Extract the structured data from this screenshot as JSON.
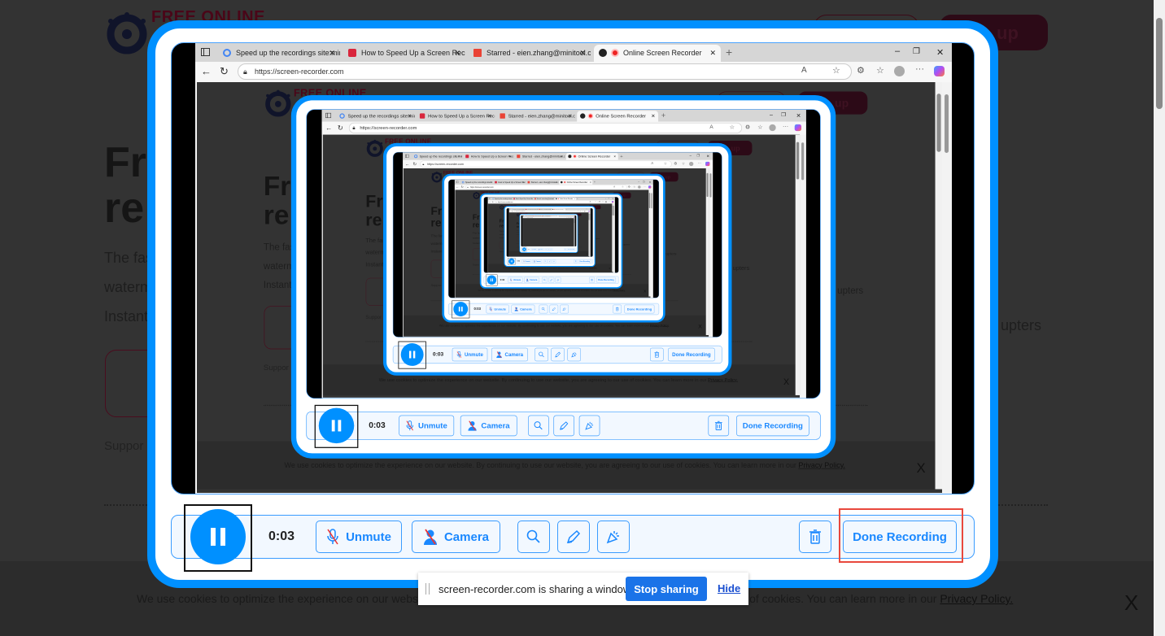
{
  "site": {
    "logo_text": "FREE ONLINE",
    "signup_label": "up",
    "headline_1": "Fr",
    "headline_2": "re",
    "para_1": "The fas",
    "para_2": "waterm",
    "para_3": "Instant",
    "support": "Suppor",
    "chapters": "upters",
    "cookie_text": "We use cookies to optimize the experience on our website. By continuing to use our website, you are agreeing to our use of cookies. You can learn more in our",
    "cookie_link": "Privacy Policy.",
    "cookie_close": "X"
  },
  "browser": {
    "tabs": [
      {
        "label": "Speed up the recordings site:mini"
      },
      {
        "label": "How to Speed Up a Screen Recor"
      },
      {
        "label": "Starred - eien.zhang@minitool.co"
      },
      {
        "label": "Online Screen Recorder"
      }
    ],
    "url": "https://screen-recorder.com"
  },
  "recorder": {
    "timer": "0:03",
    "unmute_label": "Unmute",
    "camera_label": "Camera",
    "done_label": "Done Recording",
    "accent": "#0090ff"
  },
  "share_bar": {
    "message": "screen-recorder.com is sharing a window.",
    "stop_label": "Stop sharing",
    "hide_label": "Hide"
  }
}
